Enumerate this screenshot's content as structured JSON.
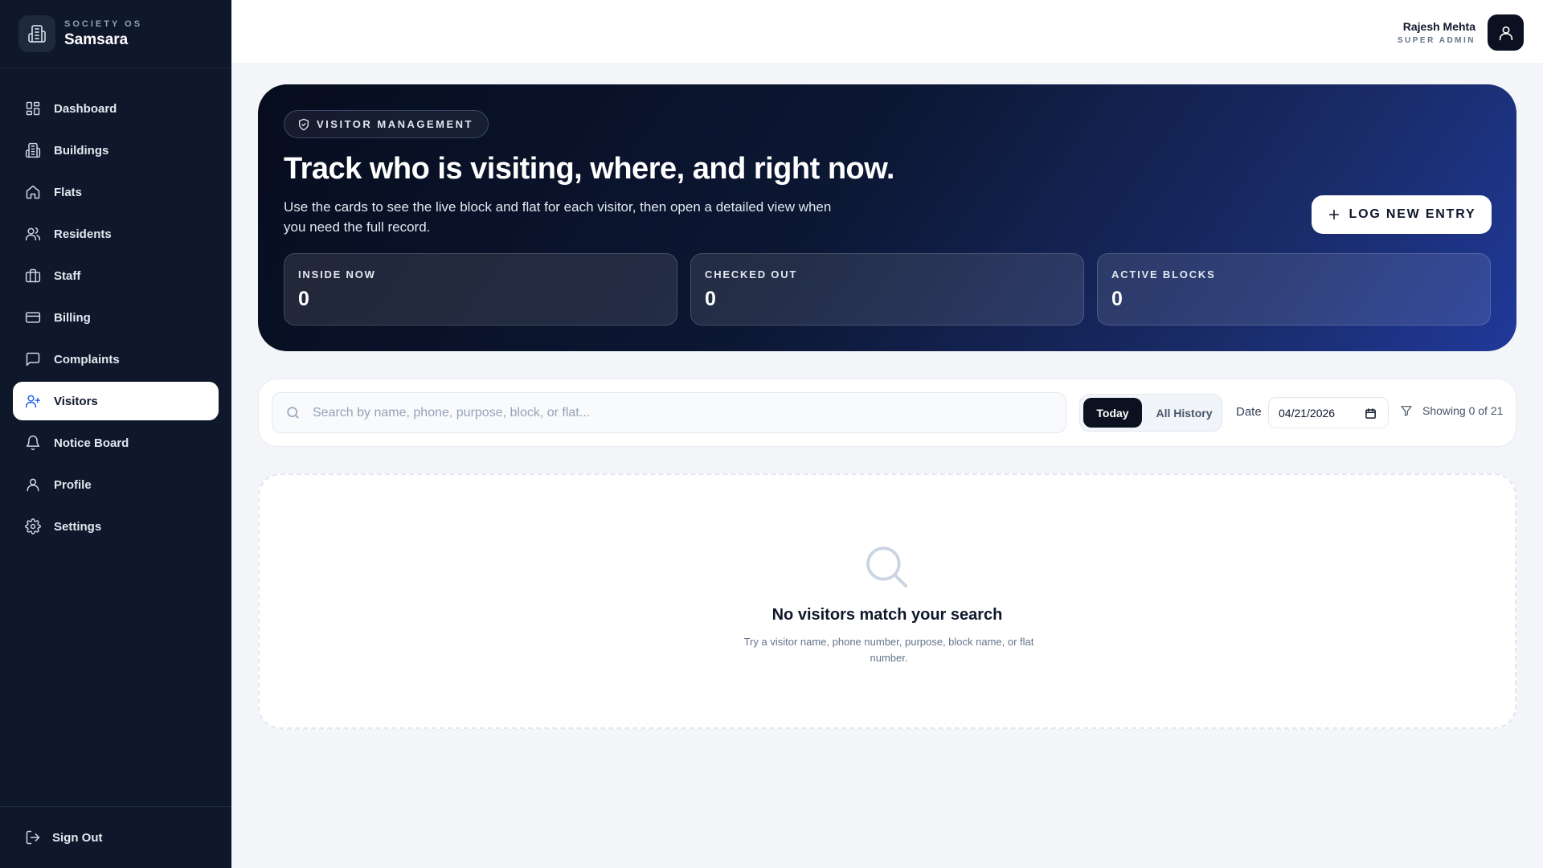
{
  "brand": {
    "kicker": "SOCIETY OS",
    "name": "Samsara"
  },
  "nav": [
    {
      "label": "Dashboard",
      "icon": "dashboard-icon"
    },
    {
      "label": "Buildings",
      "icon": "buildings-icon"
    },
    {
      "label": "Flats",
      "icon": "home-icon"
    },
    {
      "label": "Residents",
      "icon": "users-icon"
    },
    {
      "label": "Staff",
      "icon": "briefcase-icon"
    },
    {
      "label": "Billing",
      "icon": "credit-card-icon"
    },
    {
      "label": "Complaints",
      "icon": "message-square-icon"
    },
    {
      "label": "Visitors",
      "icon": "user-plus-icon",
      "active": true
    },
    {
      "label": "Notice Board",
      "icon": "bell-icon"
    },
    {
      "label": "Profile",
      "icon": "user-icon"
    },
    {
      "label": "Settings",
      "icon": "gear-icon"
    }
  ],
  "signout": {
    "label": "Sign Out"
  },
  "user": {
    "name": "Rajesh Mehta",
    "role": "SUPER ADMIN"
  },
  "hero": {
    "pill": "VISITOR MANAGEMENT",
    "title": "Track who is visiting, where, and right now.",
    "subtitle": "Use the cards to see the live block and flat for each visitor, then open a detailed view when you need the full record.",
    "cta": "LOG NEW ENTRY"
  },
  "stats": [
    {
      "label": "INSIDE NOW",
      "value": "0"
    },
    {
      "label": "CHECKED OUT",
      "value": "0"
    },
    {
      "label": "ACTIVE BLOCKS",
      "value": "0"
    }
  ],
  "filters": {
    "search_placeholder": "Search by name, phone, purpose, block, or flat...",
    "search_value": "",
    "seg_today": "Today",
    "seg_all": "All History",
    "date_label": "Date",
    "date_value": "04/21/2026",
    "showing": "Showing 0 of 21"
  },
  "empty": {
    "title": "No visitors match your search",
    "subtitle": "Try a visitor name, phone number, purpose, block name, or flat number."
  },
  "colors": {
    "sidebar_bg": "#0f172a",
    "accent": "#2563eb",
    "hero_start": "#070d1e",
    "hero_end": "#20399a"
  }
}
